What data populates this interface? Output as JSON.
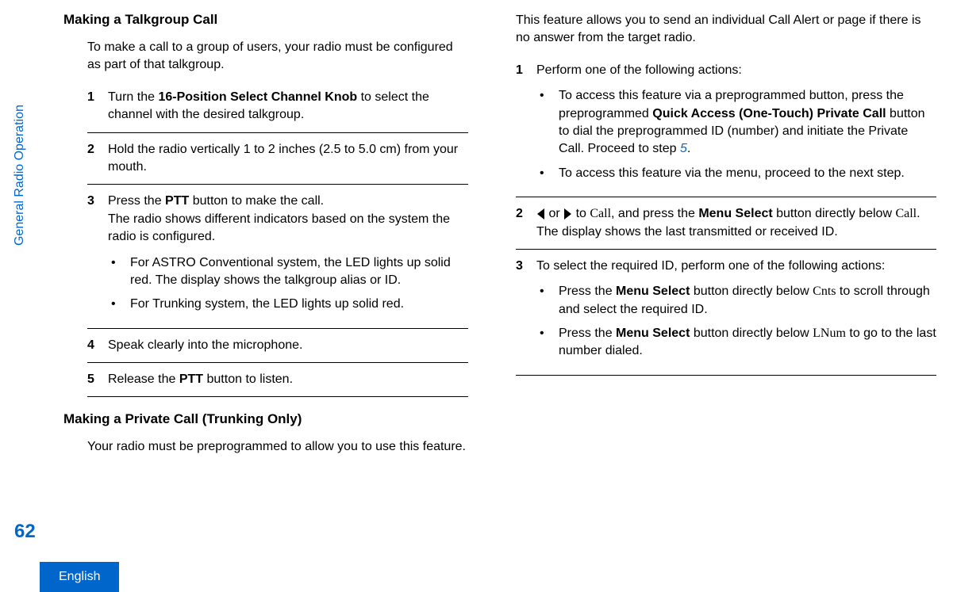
{
  "sidebar": {
    "label": "General Radio Operation",
    "page_number": "62",
    "language": "English"
  },
  "section1": {
    "heading": "Making a Talkgroup Call",
    "intro": "To make a call to a group of users, your radio must be configured as part of that talkgroup.",
    "steps": [
      {
        "num": "1",
        "pre": "Turn the ",
        "bold1": "16-Position Select Channel Knob",
        "post": " to select the channel with the desired talkgroup."
      },
      {
        "num": "2",
        "text": "Hold the radio vertically 1 to 2 inches (2.5 to 5.0 cm) from your mouth."
      },
      {
        "num": "3",
        "pre": "Press the ",
        "bold1": "PTT",
        "mid": " button to make the call.",
        "line2": "The radio shows different indicators based on the system the radio is configured.",
        "bullets": [
          "For ASTRO Conventional system, the LED lights up solid red. The display shows the talkgroup alias or ID.",
          "For Trunking system, the LED lights up solid red."
        ]
      },
      {
        "num": "4",
        "text": "Speak clearly into the microphone."
      },
      {
        "num": "5",
        "pre": "Release the ",
        "bold1": "PTT",
        "post": " button to listen."
      }
    ]
  },
  "section2": {
    "heading": "Making a Private Call (Trunking Only)",
    "intro": "Your radio must be preprogrammed to allow you to use this feature."
  },
  "col2": {
    "top": "This feature allows you to send an individual Call Alert or page if there is no answer from the target radio.",
    "step1": {
      "num": "1",
      "text": "Perform one of the following actions:",
      "b1_pre": "To access this feature via a preprogrammed button, press the preprogrammed ",
      "b1_bold": "Quick Access (One-Touch) Private Call",
      "b1_mid": " button to dial the preprogrammed ID (number) and initiate the Private Call. Proceed to step ",
      "b1_link": "5",
      "b1_post": ".",
      "b2": "To access this feature via the menu, proceed to the next step."
    },
    "step2": {
      "num": "2",
      "or": " or ",
      "to": " to ",
      "call1": "Call",
      "mid1": ", and press the ",
      "bold1": "Menu Select",
      "mid2": " button directly below ",
      "call2": "Call",
      "post": ".",
      "line2": "The display shows the last transmitted or received ID."
    },
    "step3": {
      "num": "3",
      "text": "To select the required ID, perform one of the following actions:",
      "b1_pre": "Press the ",
      "b1_bold": "Menu Select",
      "b1_mid": " button directly below ",
      "b1_serif": "Cnts",
      "b1_post": " to scroll through and select the required ID.",
      "b2_pre": "Press the ",
      "b2_bold": "Menu Select",
      "b2_mid": " button directly below ",
      "b2_serif": "LNum",
      "b2_post": " to go to the last number dialed."
    }
  }
}
